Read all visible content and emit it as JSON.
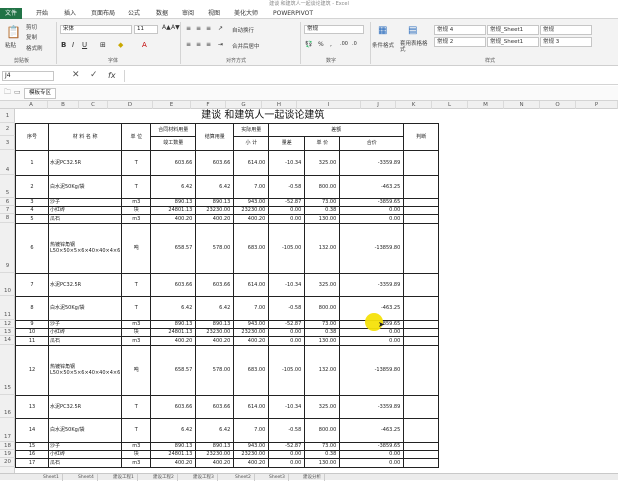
{
  "app": {
    "title": "建谈 和建筑人一起谈论建筑 - Excel"
  },
  "tabs": [
    "文件",
    "开始",
    "插入",
    "页面布局",
    "公式",
    "数据",
    "审阅",
    "视图",
    "美化大师",
    "POWERPIVOT"
  ],
  "ribbon": {
    "clipboard": {
      "paste": "粘贴",
      "cut": "剪切",
      "copy": "复制",
      "format_painter": "格式刷",
      "label": "剪贴板"
    },
    "font": {
      "name": "宋体",
      "size": "11",
      "label": "字体"
    },
    "alignment": {
      "wrap": "自动换行",
      "merge": "合并后居中",
      "label": "对齐方式"
    },
    "number": {
      "format": "常规",
      "label": "数字"
    },
    "styles": {
      "cond_format": "条件格式",
      "table_format": "套用表格格式",
      "cell1": "常规 4",
      "cell2": "常规_Sheet1",
      "cell3": "常规",
      "cell4": "常规 2",
      "cell5": "常规_Sheet1",
      "cell6": "常规 3",
      "label": "样式"
    }
  },
  "formula_bar": {
    "name_box": "J4",
    "fx": "fx",
    "value": ""
  },
  "quick": {
    "doc_tab": "模板专区"
  },
  "columns": [
    "A",
    "B",
    "C",
    "D",
    "E",
    "F",
    "G",
    "H",
    "I",
    "J",
    "K",
    "L",
    "M",
    "N",
    "O",
    "P"
  ],
  "rows": [
    "1",
    "2",
    "3",
    "4",
    "5",
    "6",
    "7",
    "8",
    "9",
    "10",
    "11",
    "12",
    "13",
    "14",
    "15",
    "16",
    "17",
    "18",
    "19",
    "20"
  ],
  "sheet": {
    "title": "建谈   和建筑人一起谈论建筑",
    "h_seq": "序号",
    "h_material": "材 料 名 称",
    "h_unit": "单 位",
    "h_contract": "合同材料用量",
    "h_settle": "结算用量",
    "h_actual": "实际用量",
    "h_diff": "差额",
    "h_judge": "判断",
    "h_work_qty": "竣工数量",
    "h_subtotal": "小 计",
    "h_qty_diff": "量差",
    "h_price": "单 价",
    "h_total": "合价",
    "data": [
      [
        "1",
        "水泥PC32.5R",
        "T",
        "603.66",
        "603.66",
        "614.00",
        "-10.34",
        "325.00",
        "-3359.89"
      ],
      [
        "2",
        "白水泥50Kg/袋",
        "T",
        "6.42",
        "6.42",
        "7.00",
        "-0.58",
        "800.00",
        "-463.25"
      ],
      [
        "3",
        "沙子",
        "m3",
        "890.13",
        "890.13",
        "943.00",
        "-52.87",
        "73.00",
        "-3859.65"
      ],
      [
        "4",
        "小红砖",
        "块",
        "24801.13",
        "23230.00",
        "23230.00",
        "0.00",
        "0.38",
        "0.00"
      ],
      [
        "5",
        "瓜石",
        "m3",
        "400.20",
        "400.20",
        "400.20",
        "0.00",
        "130.00",
        "0.00"
      ],
      [
        "6",
        "热镀锌角钢L50×50×5×6×40×40×4×6",
        "吨",
        "658.57",
        "578.00",
        "683.00",
        "-105.00",
        "132.00",
        "-13859.80"
      ],
      [
        "7",
        "水泥PC32.5R",
        "T",
        "603.66",
        "603.66",
        "614.00",
        "-10.34",
        "325.00",
        "-3359.89"
      ],
      [
        "8",
        "白水泥50Kg/袋",
        "T",
        "6.42",
        "6.42",
        "7.00",
        "-0.58",
        "800.00",
        "-463.25"
      ],
      [
        "9",
        "沙子",
        "m3",
        "890.13",
        "890.13",
        "943.00",
        "-52.87",
        "73.00",
        "-3859.65"
      ],
      [
        "10",
        "小红砖",
        "块",
        "24801.13",
        "23230.00",
        "23230.00",
        "0.00",
        "0.38",
        "0.00"
      ],
      [
        "11",
        "瓜石",
        "m3",
        "400.20",
        "400.20",
        "400.20",
        "0.00",
        "130.00",
        "0.00"
      ],
      [
        "12",
        "热镀锌角钢L50×50×5×6×40×40×4×6",
        "吨",
        "658.57",
        "578.00",
        "683.00",
        "-105.00",
        "132.00",
        "-13859.80"
      ],
      [
        "13",
        "水泥PC32.5R",
        "T",
        "603.66",
        "603.66",
        "614.00",
        "-10.34",
        "325.00",
        "-3359.89"
      ],
      [
        "14",
        "白水泥50Kg/袋",
        "T",
        "6.42",
        "6.42",
        "7.00",
        "-0.58",
        "800.00",
        "-463.25"
      ],
      [
        "15",
        "沙子",
        "m3",
        "890.13",
        "890.13",
        "943.00",
        "-52.87",
        "73.00",
        "-3859.65"
      ],
      [
        "16",
        "小红砖",
        "块",
        "24801.13",
        "23230.00",
        "23230.00",
        "0.00",
        "0.38",
        "0.00"
      ],
      [
        "17",
        "瓜石",
        "m3",
        "400.20",
        "400.20",
        "400.20",
        "0.00",
        "130.00",
        "0.00"
      ]
    ]
  },
  "sheet_tabs": [
    "Sheet1",
    "Sheet4",
    "建设工程1",
    "建设工程2",
    "建设工程3",
    "Sheet2",
    "Sheet3",
    "建设分析"
  ]
}
